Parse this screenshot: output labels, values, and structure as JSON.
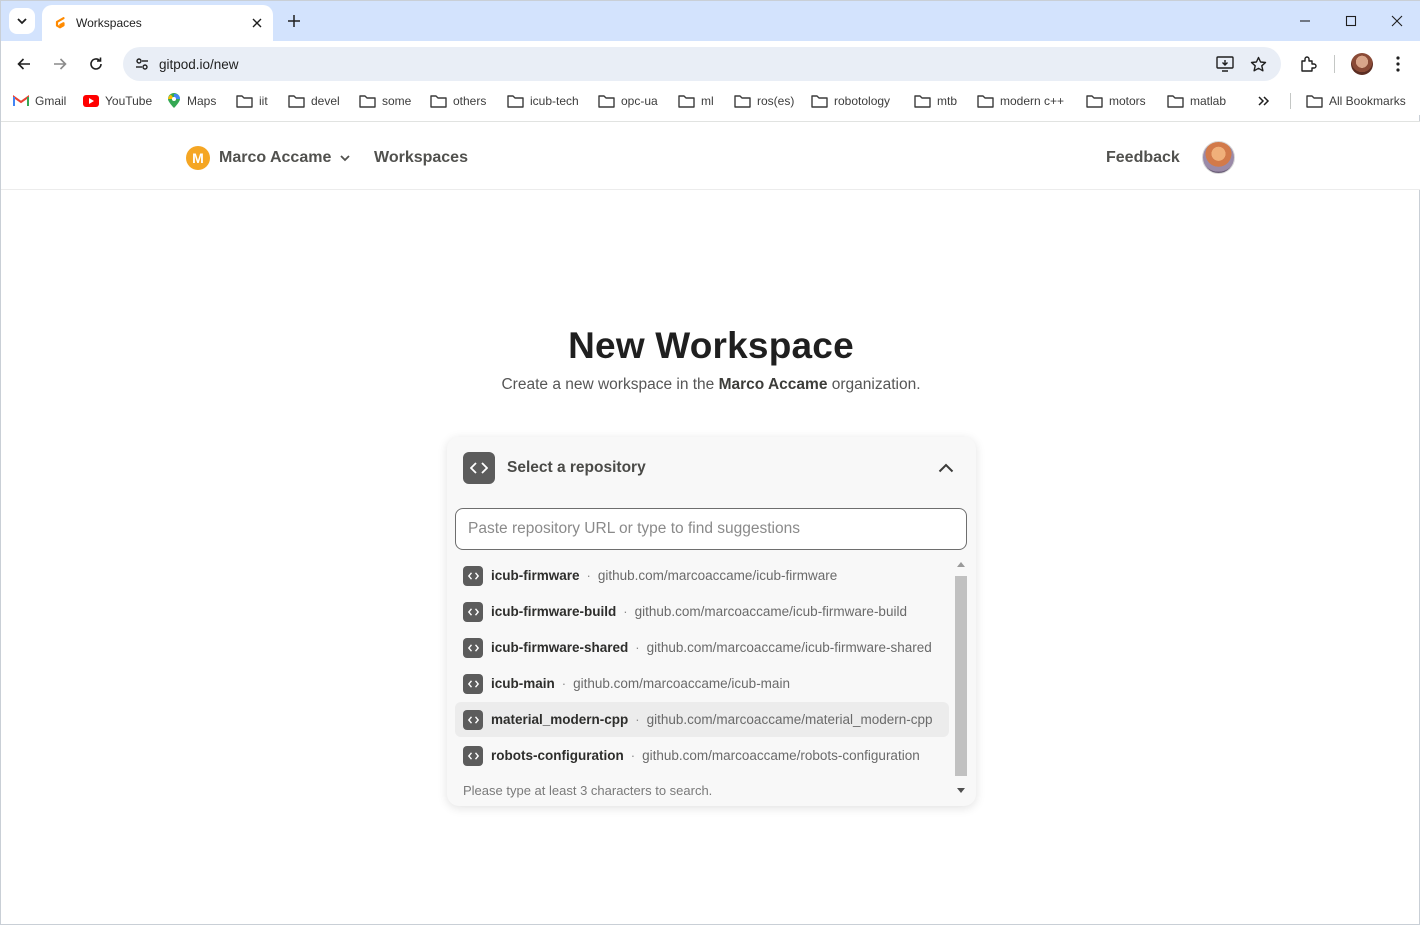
{
  "browser": {
    "tab": {
      "title": "Workspaces"
    },
    "url": "gitpod.io/new",
    "bookmarks": [
      {
        "label": "Gmail",
        "icon": "gmail-icon"
      },
      {
        "label": "YouTube",
        "icon": "youtube-icon"
      },
      {
        "label": "Maps",
        "icon": "maps-icon"
      },
      {
        "label": "iit",
        "icon": "folder-icon"
      },
      {
        "label": "devel",
        "icon": "folder-icon"
      },
      {
        "label": "some",
        "icon": "folder-icon"
      },
      {
        "label": "others",
        "icon": "folder-icon"
      },
      {
        "label": "icub-tech",
        "icon": "folder-icon"
      },
      {
        "label": "opc-ua",
        "icon": "folder-icon"
      },
      {
        "label": "ml",
        "icon": "folder-icon"
      },
      {
        "label": "ros(es)",
        "icon": "folder-icon"
      },
      {
        "label": "robotology",
        "icon": "folder-icon"
      },
      {
        "label": "mtb",
        "icon": "folder-icon"
      },
      {
        "label": "modern c++",
        "icon": "folder-icon"
      },
      {
        "label": "motors",
        "icon": "folder-icon"
      },
      {
        "label": "matlab",
        "icon": "folder-icon"
      }
    ],
    "all_bookmarks": "All Bookmarks"
  },
  "header": {
    "org_initial": "M",
    "org_name": "Marco Accame",
    "nav_workspaces": "Workspaces",
    "feedback": "Feedback"
  },
  "main": {
    "title": "New Workspace",
    "subtitle_prefix": "Create a new workspace in the ",
    "subtitle_org": "Marco Accame",
    "subtitle_suffix": " organization.",
    "repo_selector": {
      "label": "Select a repository",
      "input_placeholder": "Paste repository URL or type to find suggestions",
      "input_value": "",
      "items": [
        {
          "name": "icub-firmware",
          "url": "github.com/marcoaccame/icub-firmware"
        },
        {
          "name": "icub-firmware-build",
          "url": "github.com/marcoaccame/icub-firmware-build"
        },
        {
          "name": "icub-firmware-shared",
          "url": "github.com/marcoaccame/icub-firmware-shared"
        },
        {
          "name": "icub-main",
          "url": "github.com/marcoaccame/icub-main"
        },
        {
          "name": "material_modern-cpp",
          "url": "github.com/marcoaccame/material_modern-cpp"
        },
        {
          "name": "robots-configuration",
          "url": "github.com/marcoaccame/robots-configuration"
        }
      ],
      "hint": "Please type at least 3 characters to search."
    }
  },
  "colors": {
    "tabstrip": "#d3e3fd",
    "omnibox": "#e9eef6",
    "org_badge": "#f5a623",
    "code_icon_bg": "#5c5c5c",
    "card_bg": "#f8f8f8"
  }
}
